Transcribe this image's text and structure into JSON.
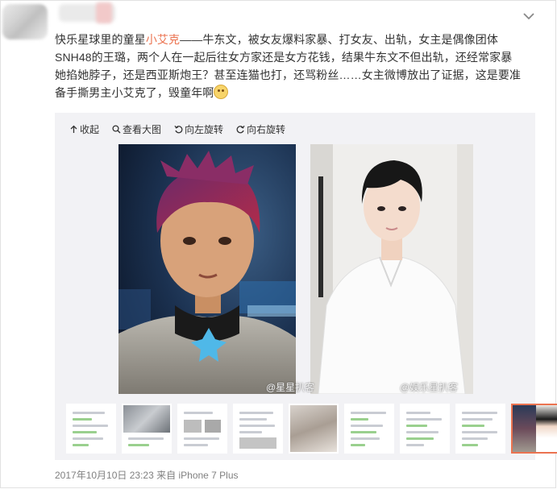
{
  "post": {
    "text_prefix": "快乐星球里的童星",
    "link": "小艾克",
    "text_suffix": "——牛东文，被女友爆料家暴、打女友、出轨，女主是偶像团体SNH48的王璐，两个人在一起后往女方家还是女方花钱，结果牛东文不但出轨，还经常家暴她掐她脖子，还是西亚斯炮王？甚至连猫也打，还骂粉丝……女主微博放出了证据，这是要准备手撕男主小艾克了，毁童年啊",
    "emoji_icon": "cat-emoji-icon"
  },
  "toolbar": {
    "collapse": "收起",
    "view_large": "查看大图",
    "rotate_left": "向左旋转",
    "rotate_right": "向右旋转"
  },
  "photos": {
    "watermark_left": "@星星扒客",
    "watermark_right": "@娱乐星扒客"
  },
  "footer": {
    "timestamp": "2017年10月10日 23:23",
    "source_prefix": "来自",
    "device": "iPhone 7 Plus"
  },
  "colors": {
    "accent": "#eb7350",
    "meta_text": "#808080",
    "media_bg": "#f2f2f5"
  },
  "thumbnail_count": 9,
  "active_thumbnail": 9
}
